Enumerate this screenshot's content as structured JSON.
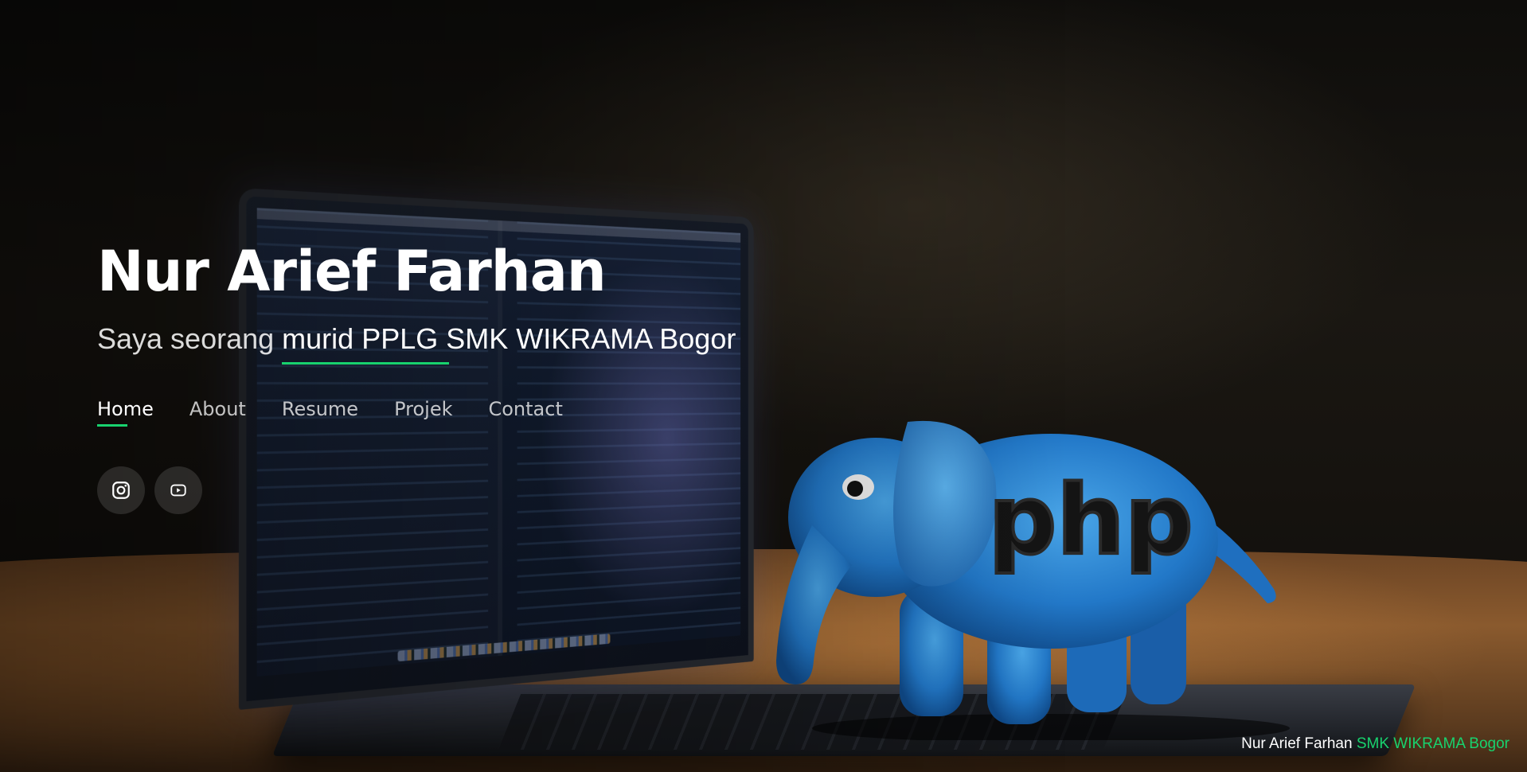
{
  "hero": {
    "name": "Nur Arief Farhan",
    "tagline_prefix": "Saya seorang",
    "tagline_typed": "murid PPLG SMK WIKRAMA Bogor"
  },
  "nav": {
    "items": [
      {
        "label": "Home",
        "active": true
      },
      {
        "label": "About",
        "active": false
      },
      {
        "label": "Resume",
        "active": false
      },
      {
        "label": "Projek",
        "active": false
      },
      {
        "label": "Contact",
        "active": false
      }
    ]
  },
  "social": {
    "icons": [
      "instagram-icon",
      "youtube-icon"
    ]
  },
  "background": {
    "mascot_text": "php"
  },
  "footer": {
    "owner": "Nur Arief Farhan",
    "school": "SMK WIKRAMA Bogor"
  },
  "colors": {
    "accent": "#18d26e",
    "text": "#ffffff",
    "social_bg": "rgba(255,255,255,0.12)"
  }
}
